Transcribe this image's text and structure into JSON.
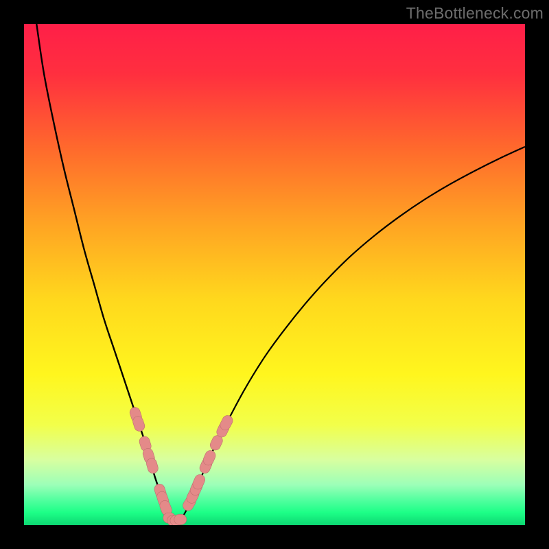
{
  "watermark": "TheBottleneck.com",
  "colors": {
    "black": "#000000",
    "gradient_stops": [
      {
        "pos": 0.0,
        "color": "#ff1f48"
      },
      {
        "pos": 0.1,
        "color": "#ff2f3f"
      },
      {
        "pos": 0.25,
        "color": "#ff6a2c"
      },
      {
        "pos": 0.4,
        "color": "#ffa423"
      },
      {
        "pos": 0.55,
        "color": "#ffd81d"
      },
      {
        "pos": 0.7,
        "color": "#fff61e"
      },
      {
        "pos": 0.8,
        "color": "#f2ff4a"
      },
      {
        "pos": 0.87,
        "color": "#d8ffa0"
      },
      {
        "pos": 0.92,
        "color": "#9cffb8"
      },
      {
        "pos": 0.95,
        "color": "#52ff9f"
      },
      {
        "pos": 0.975,
        "color": "#1dff87"
      },
      {
        "pos": 1.0,
        "color": "#0dd872"
      }
    ],
    "curve_stroke": "#000000",
    "marker_fill": "#e48a89",
    "marker_stroke": "#bd6f6e"
  },
  "chart_data": {
    "type": "line",
    "title": "",
    "xlabel": "",
    "ylabel": "",
    "xlim": [
      0,
      100
    ],
    "ylim": [
      0,
      100
    ],
    "left_curve": {
      "x": [
        2.5,
        4,
        6,
        8,
        10,
        12,
        14,
        16,
        18,
        20,
        22,
        24,
        25,
        26,
        27,
        28,
        29,
        29.5
      ],
      "y": [
        100,
        90,
        80,
        71,
        63,
        55,
        48,
        41,
        35,
        29,
        23,
        17,
        13.5,
        10,
        7,
        4,
        1.8,
        0.9
      ]
    },
    "right_curve": {
      "x": [
        31,
        32,
        33,
        34,
        36,
        38,
        40,
        44,
        48,
        52,
        56,
        60,
        65,
        70,
        75,
        80,
        85,
        90,
        95,
        100
      ],
      "y": [
        0.9,
        2.2,
        4.2,
        6.4,
        11,
        15.5,
        19.5,
        27,
        33.5,
        39,
        44,
        48.5,
        53.5,
        57.8,
        61.6,
        65,
        68,
        70.7,
        73.2,
        75.5
      ]
    },
    "floor_segment": {
      "x": [
        29.5,
        31
      ],
      "y": [
        0.9,
        0.9
      ]
    },
    "markers_left": [
      {
        "x": 22.3,
        "y": 22.0
      },
      {
        "x": 22.9,
        "y": 20.2
      },
      {
        "x": 24.2,
        "y": 16.2
      },
      {
        "x": 24.9,
        "y": 13.8
      },
      {
        "x": 25.6,
        "y": 11.8
      },
      {
        "x": 27.2,
        "y": 6.7
      },
      {
        "x": 27.7,
        "y": 5.2
      },
      {
        "x": 28.3,
        "y": 3.4
      }
    ],
    "markers_floor": [
      {
        "x": 29.0,
        "y": 1.4
      },
      {
        "x": 29.8,
        "y": 0.9
      },
      {
        "x": 30.4,
        "y": 0.9
      },
      {
        "x": 31.2,
        "y": 1.1
      }
    ],
    "markers_right": [
      {
        "x": 33.0,
        "y": 4.3
      },
      {
        "x": 33.7,
        "y": 5.8
      },
      {
        "x": 34.4,
        "y": 7.4
      },
      {
        "x": 34.9,
        "y": 8.6
      },
      {
        "x": 36.3,
        "y": 11.8
      },
      {
        "x": 37.0,
        "y": 13.4
      },
      {
        "x": 38.4,
        "y": 16.4
      },
      {
        "x": 39.7,
        "y": 19.0
      },
      {
        "x": 40.4,
        "y": 20.4
      }
    ]
  }
}
